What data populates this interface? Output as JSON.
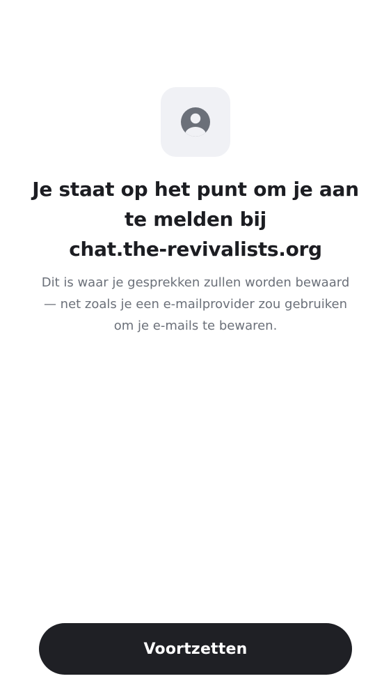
{
  "header": {
    "icon": "user-circle-icon",
    "icon_color": "#6b7079",
    "tile_color": "#f0f1f5"
  },
  "title": {
    "lines": [
      "Je staat op het punt om je aan",
      "te melden bij",
      "chat.the-revivalists.org"
    ]
  },
  "description": {
    "lines": [
      "Dit is waar je gesprekken zullen worden bewaard",
      "— net zoals je een e-mailprovider zou gebruiken",
      "om je e-mails te bewaren."
    ]
  },
  "actions": {
    "continue_label": "Voortzetten",
    "button_color": "#1f2025"
  }
}
